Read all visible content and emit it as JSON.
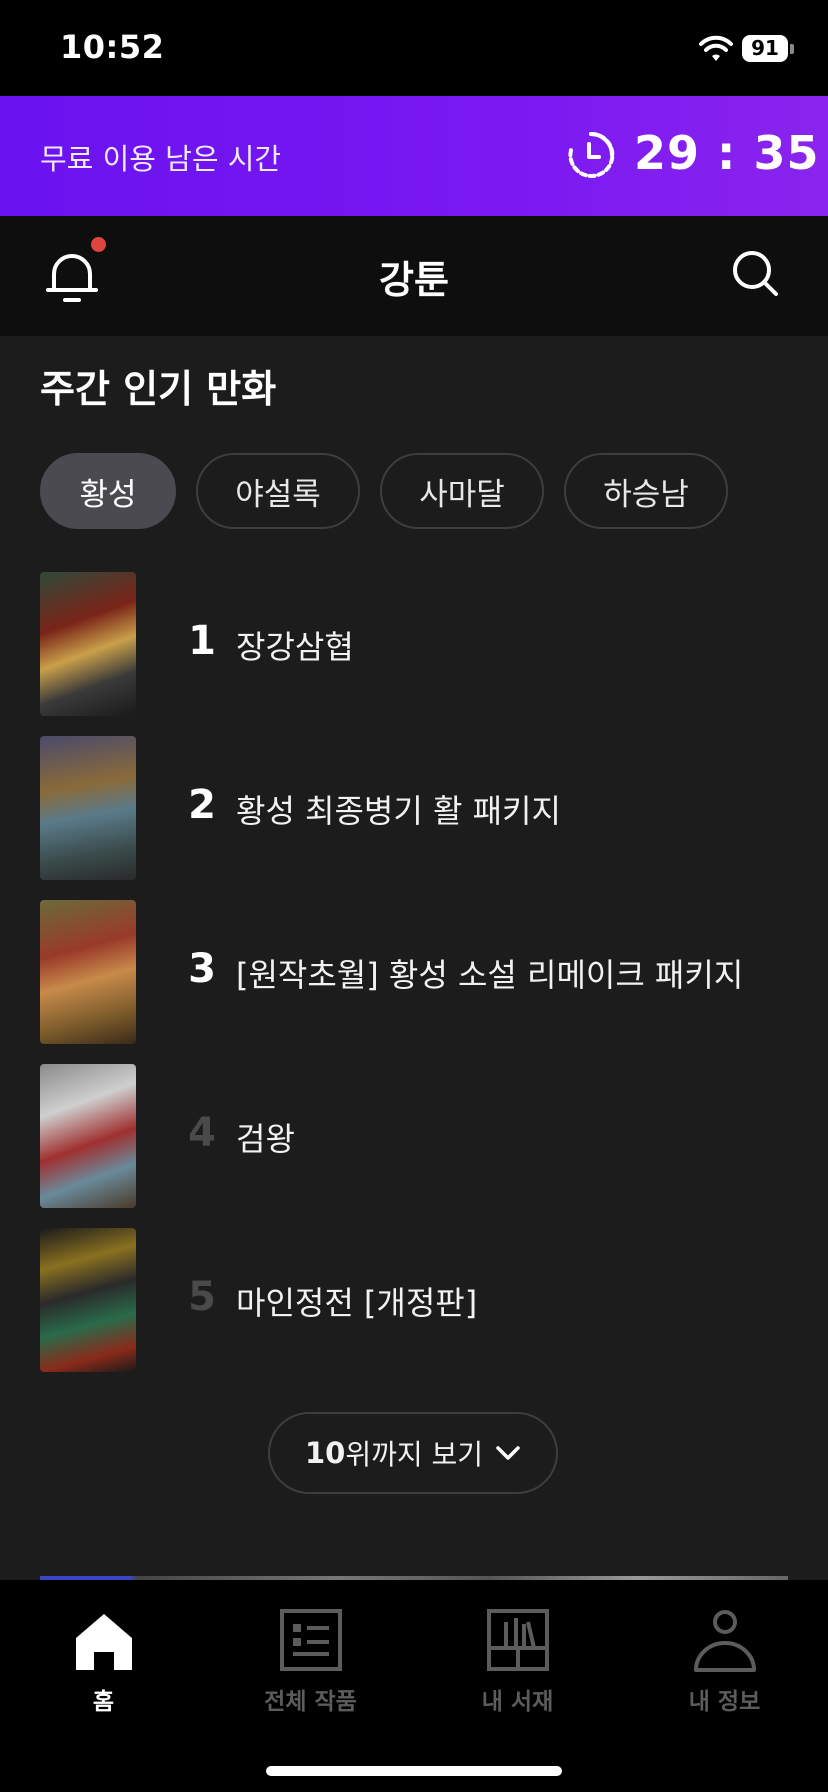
{
  "status_bar": {
    "time": "10:52",
    "battery": "91"
  },
  "timer_banner": {
    "label": "무료 이용 남은 시간",
    "remaining": "29 : 35"
  },
  "app_bar": {
    "title": "강툰"
  },
  "weekly_popular": {
    "title": "주간 인기 만화",
    "filters": [
      {
        "label": "황성",
        "selected": true
      },
      {
        "label": "야설록",
        "selected": false
      },
      {
        "label": "사마달",
        "selected": false
      },
      {
        "label": "하승남",
        "selected": false
      }
    ],
    "items": [
      {
        "rank": "1",
        "title": "장강삼협"
      },
      {
        "rank": "2",
        "title": "황성 최종병기 활 패키지"
      },
      {
        "rank": "3",
        "title": "[원작초월] 황성 소설 리메이크 패키지"
      },
      {
        "rank": "4",
        "title": "검왕"
      },
      {
        "rank": "5",
        "title": "마인정전 [개정판]"
      }
    ],
    "more_button": {
      "number": "10",
      "label": "위까지 보기"
    }
  },
  "tab_bar": {
    "tabs": [
      {
        "label": "홈",
        "icon": "home-icon",
        "active": true
      },
      {
        "label": "전체 작품",
        "icon": "list-icon",
        "active": false
      },
      {
        "label": "내 서재",
        "icon": "bookshelf-icon",
        "active": false
      },
      {
        "label": "내 정보",
        "icon": "person-icon",
        "active": false
      }
    ]
  },
  "colors": {
    "timer_gradient_start": "#6a12f0",
    "timer_gradient_end": "#8a24ee",
    "background": "#1c1c1c",
    "notification_dot": "#e0443e",
    "chip_selected": "#4a4a50"
  }
}
